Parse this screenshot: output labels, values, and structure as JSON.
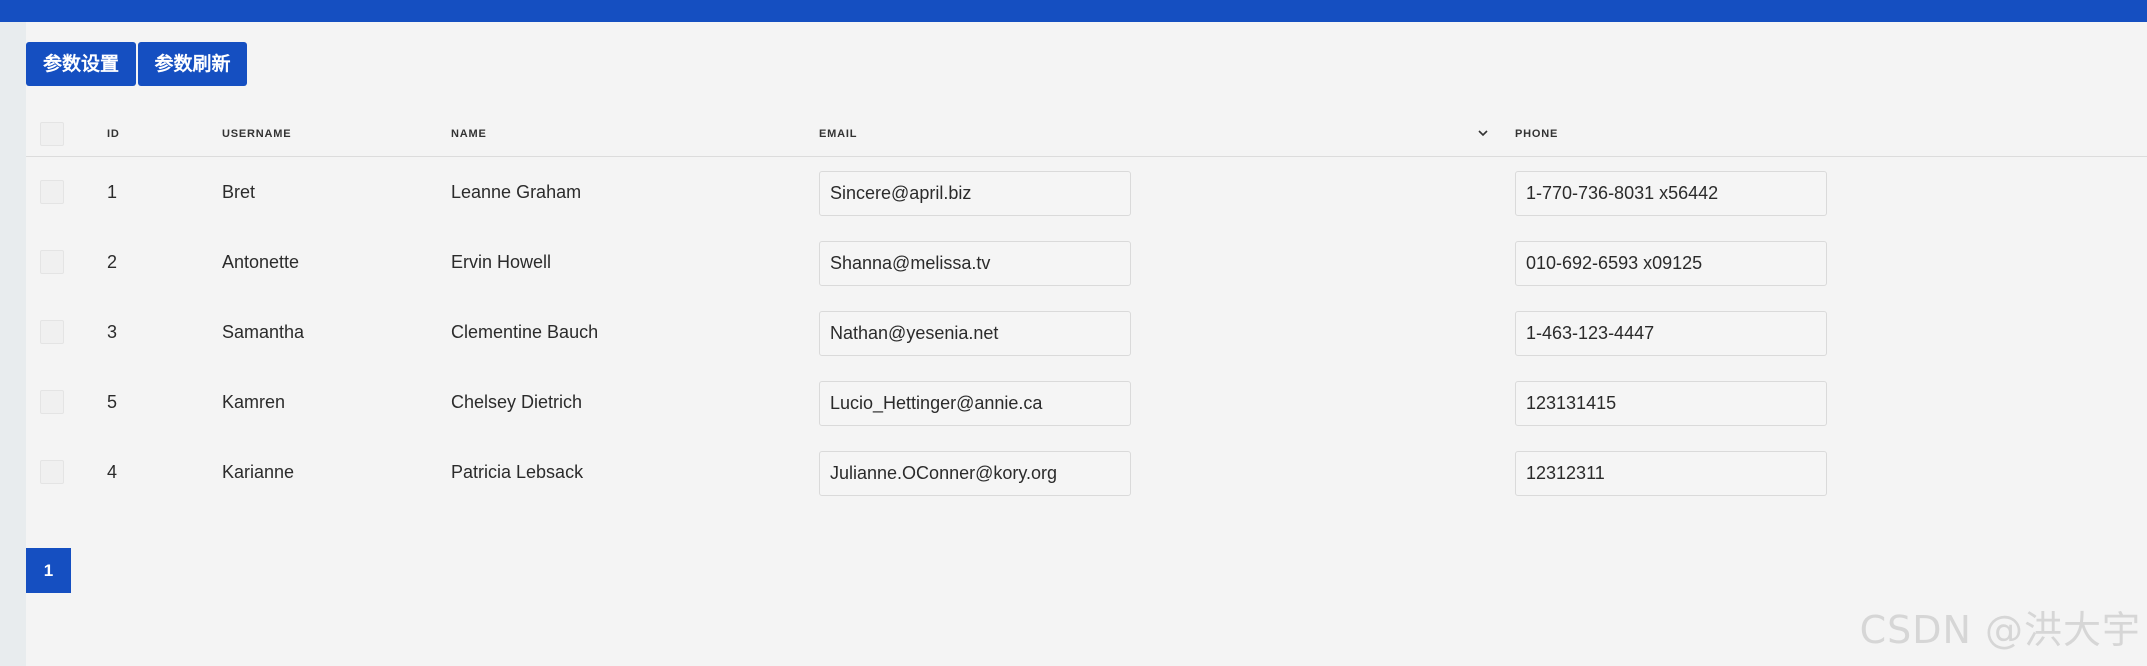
{
  "colors": {
    "accent": "#154fc1",
    "background": "#f4f4f4"
  },
  "toolbar": {
    "settings_label": "参数设置",
    "refresh_label": "参数刷新"
  },
  "table": {
    "columns": [
      "ID",
      "USERNAME",
      "NAME",
      "EMAIL",
      "PHONE"
    ],
    "sort_icon": "chevron-down-icon",
    "rows": [
      {
        "id": "1",
        "username": "Bret",
        "name": "Leanne Graham",
        "email": "Sincere@april.biz",
        "phone": "1-770-736-8031 x56442"
      },
      {
        "id": "2",
        "username": "Antonette",
        "name": "Ervin Howell",
        "email": "Shanna@melissa.tv",
        "phone": "010-692-6593 x09125"
      },
      {
        "id": "3",
        "username": "Samantha",
        "name": "Clementine Bauch",
        "email": "Nathan@yesenia.net",
        "phone": "1-463-123-4447"
      },
      {
        "id": "5",
        "username": "Kamren",
        "name": "Chelsey Dietrich",
        "email": "Lucio_Hettinger@annie.ca",
        "phone": "123131415"
      },
      {
        "id": "4",
        "username": "Karianne",
        "name": "Patricia Lebsack",
        "email": "Julianne.OConner@kory.org",
        "phone": "12312311"
      }
    ]
  },
  "pagination": {
    "current_page": "1"
  },
  "watermark": "CSDN @洪大宇"
}
